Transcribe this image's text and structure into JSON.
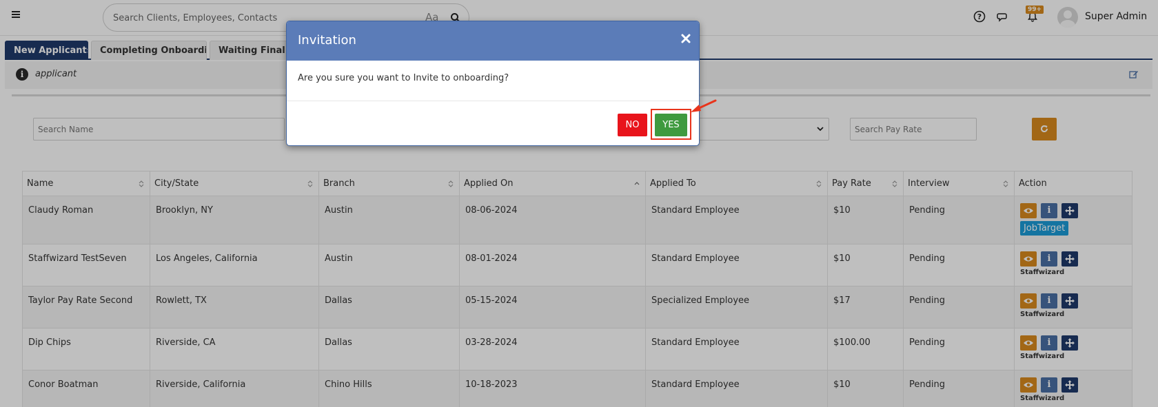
{
  "header": {
    "search_placeholder": "Search Clients, Employees, Contacts",
    "search_aa": "Aa",
    "notification_badge": "99+",
    "user_name": "Super Admin"
  },
  "tabs": [
    {
      "label": "New Applicants",
      "active": true
    },
    {
      "label": "Completing Onboarding",
      "active": false
    },
    {
      "label": "Waiting Final Ap",
      "active": false
    }
  ],
  "info": {
    "text": "applicant"
  },
  "filters": {
    "name_placeholder": "Search Name",
    "payrate_placeholder": "Search Pay Rate"
  },
  "table": {
    "columns": [
      "Name",
      "City/State",
      "Branch",
      "Applied On",
      "Applied To",
      "Pay Rate",
      "Interview",
      "Action"
    ],
    "rows": [
      {
        "name": "Claudy Roman",
        "city": "Brooklyn, NY",
        "branch": "Austin",
        "applied_on": "08-06-2024",
        "applied_to": "Standard Employee",
        "pay_rate": "$10",
        "interview": "Pending",
        "source": "JobTarget"
      },
      {
        "name": "Staffwizard TestSeven",
        "city": "Los Angeles, California",
        "branch": "Austin",
        "applied_on": "08-01-2024",
        "applied_to": "Standard Employee",
        "pay_rate": "$10",
        "interview": "Pending",
        "source": "Staffwizard"
      },
      {
        "name": "Taylor Pay Rate Second",
        "city": "Rowlett, TX",
        "branch": "Dallas",
        "applied_on": "05-15-2024",
        "applied_to": "Specialized Employee",
        "pay_rate": "$17",
        "interview": "Pending",
        "source": "Staffwizard"
      },
      {
        "name": "Dip Chips",
        "city": "Riverside, CA",
        "branch": "Dallas",
        "applied_on": "03-28-2024",
        "applied_to": "Standard Employee",
        "pay_rate": "$100.00",
        "interview": "Pending",
        "source": "Staffwizard"
      },
      {
        "name": "Conor Boatman",
        "city": "Riverside, California",
        "branch": "Chino Hills",
        "applied_on": "10-18-2023",
        "applied_to": "Standard Employee",
        "pay_rate": "$10",
        "interview": "Pending",
        "source": "Staffwizard"
      }
    ]
  },
  "modal": {
    "title": "Invitation",
    "message": "Are you sure you want to Invite to onboarding?",
    "no_label": "NO",
    "yes_label": "YES"
  },
  "colors": {
    "brand_navy": "#1f3a6b",
    "modal_header": "#5b7cb8",
    "accent_orange": "#d98a1e",
    "no_red": "#e8141b",
    "yes_green": "#3f9a3f",
    "highlight_red": "#e8341b"
  }
}
